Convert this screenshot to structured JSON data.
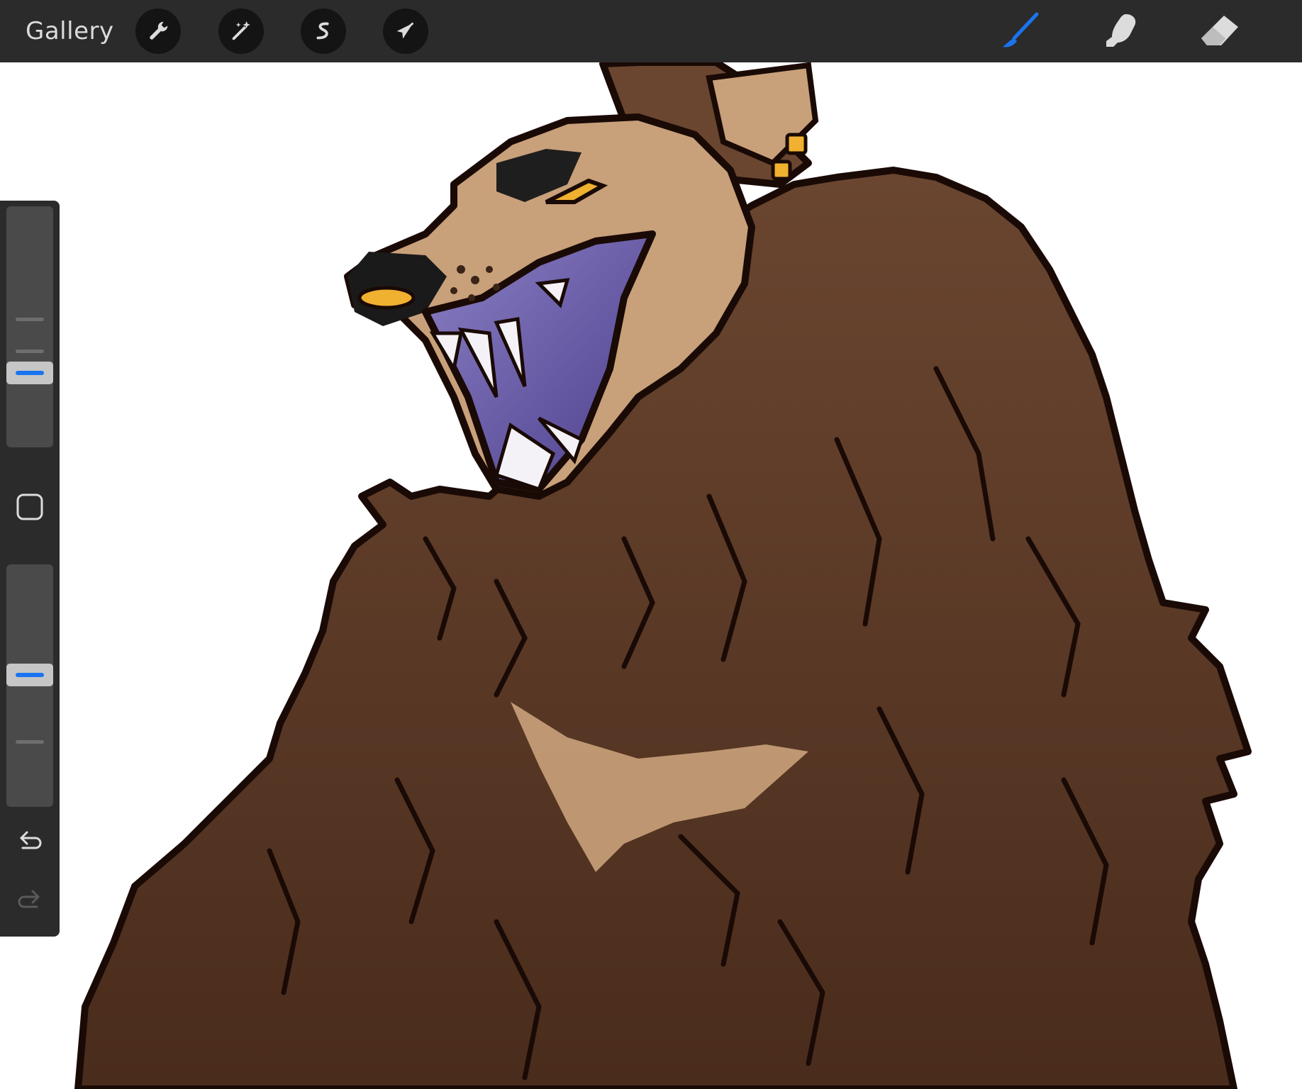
{
  "toolbar": {
    "gallery_label": "Gallery",
    "left_tools": [
      {
        "name": "actions",
        "icon": "wrench-icon"
      },
      {
        "name": "adjustments",
        "icon": "magic-wand-icon"
      },
      {
        "name": "selection",
        "icon": "selection-s-icon"
      },
      {
        "name": "transform",
        "icon": "arrow-cursor-icon"
      }
    ],
    "right_tools": [
      {
        "name": "brush",
        "icon": "brush-icon",
        "active": true
      },
      {
        "name": "smudge",
        "icon": "smudge-finger-icon",
        "active": false
      },
      {
        "name": "eraser",
        "icon": "eraser-icon",
        "active": false
      }
    ]
  },
  "sidebar": {
    "brush_size_level": 0.29,
    "opacity_level": 0.55,
    "modify_icon": "square-icon",
    "undo_icon": "undo-icon",
    "redo_icon": "redo-icon"
  },
  "colors": {
    "toolbar_bg": "#2b2b2b",
    "accent_active": "#1a73f0",
    "icon_default": "#dcdcdc",
    "fur_brown": "#5a3826",
    "fur_tan": "#c8a07a",
    "mouth_purple": "#6c5fa6",
    "eye_gold": "#f0b030"
  },
  "canvas": {
    "artwork": "snarling-werewolf-illustration"
  }
}
